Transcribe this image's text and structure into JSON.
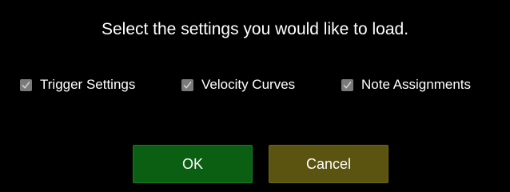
{
  "dialog": {
    "title": "Select the settings you would like to load.",
    "options": [
      {
        "label": "Trigger Settings",
        "checked": true,
        "icon": "checkmark-icon"
      },
      {
        "label": "Velocity Curves",
        "checked": true,
        "icon": "checkmark-icon"
      },
      {
        "label": "Note Assignments",
        "checked": true,
        "icon": "checkmark-icon"
      }
    ],
    "buttons": {
      "ok_label": "OK",
      "cancel_label": "Cancel"
    }
  },
  "colors": {
    "background": "#000000",
    "text": "#ffffff",
    "checkbox_fill": "#7a7a7a",
    "checkmark": "#d0d0d0",
    "ok_button": "#0b5f12",
    "cancel_button": "#5b5410"
  }
}
